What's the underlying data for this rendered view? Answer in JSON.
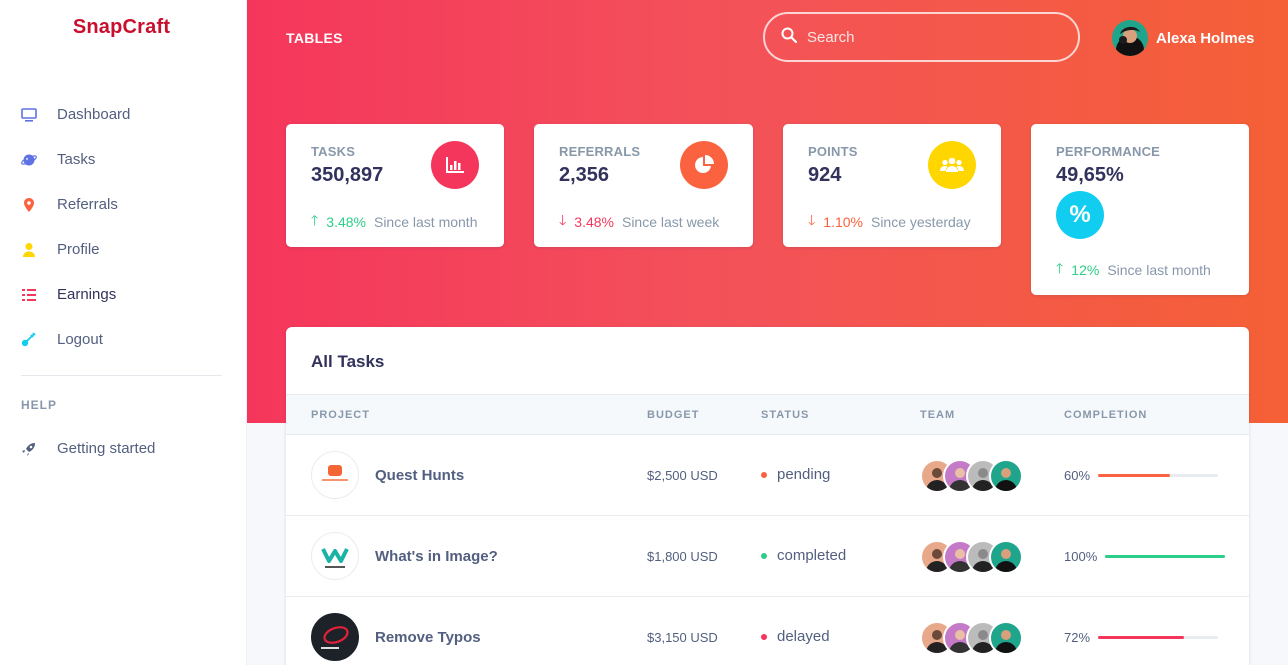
{
  "brand": "SnapCraft",
  "sidebar": {
    "items": [
      {
        "label": "Dashboard",
        "icon": "monitor-icon",
        "color": "#5e72e4"
      },
      {
        "label": "Tasks",
        "icon": "planet-icon",
        "color": "#5e72e4"
      },
      {
        "label": "Referrals",
        "icon": "pin-icon",
        "color": "#fb6340"
      },
      {
        "label": "Profile",
        "icon": "user-icon",
        "color": "#ffd600"
      },
      {
        "label": "Earnings",
        "icon": "list-icon",
        "color": "#f5365c"
      },
      {
        "label": "Logout",
        "icon": "key-icon",
        "color": "#11cdef"
      }
    ],
    "help_heading": "HELP",
    "help_items": [
      {
        "label": "Getting started",
        "icon": "spaceship-icon"
      }
    ]
  },
  "header": {
    "title": "TABLES",
    "search_placeholder": "Search",
    "user_name": "Alexa Holmes"
  },
  "stats": [
    {
      "label": "TASKS",
      "value": "350,897",
      "change": "3.48%",
      "direction": "up",
      "since": "Since last month",
      "icon": "chart-bar-icon",
      "color": "#f5365c"
    },
    {
      "label": "REFERRALS",
      "value": "2,356",
      "change": "3.48%",
      "direction": "down",
      "since": "Since last week",
      "icon": "chart-pie-icon",
      "color": "#fb6340"
    },
    {
      "label": "POINTS",
      "value": "924",
      "change": "1.10%",
      "direction": "down",
      "since": "Since yesterday",
      "icon": "users-icon",
      "color": "#ffd600"
    },
    {
      "label": "PERFORMANCE",
      "value": "49,65%",
      "change": "12%",
      "direction": "up",
      "since": "Since last month",
      "icon": "percent-icon",
      "color": "#11cdef"
    }
  ],
  "table": {
    "title": "All Tasks",
    "columns": [
      "PROJECT",
      "BUDGET",
      "STATUS",
      "TEAM",
      "COMPLETION"
    ],
    "rows": [
      {
        "project": "Quest Hunts",
        "logo": "gsk-logo",
        "budget": "$2,500 USD",
        "status": "pending",
        "status_color": "#fb6340",
        "completion": "60%",
        "completion_value": 60,
        "bar_color": "#fb6340"
      },
      {
        "project": "What's in Image?",
        "logo": "waymo-logo",
        "budget": "$1,800 USD",
        "status": "completed",
        "status_color": "#2dce89",
        "completion": "100%",
        "completion_value": 100,
        "bar_color": "#2dce89"
      },
      {
        "project": "Remove Typos",
        "logo": "twiggle-logo",
        "budget": "$3,150 USD",
        "status": "delayed",
        "status_color": "#f5365c",
        "completion": "72%",
        "completion_value": 72,
        "bar_color": "#f5365c"
      }
    ]
  }
}
